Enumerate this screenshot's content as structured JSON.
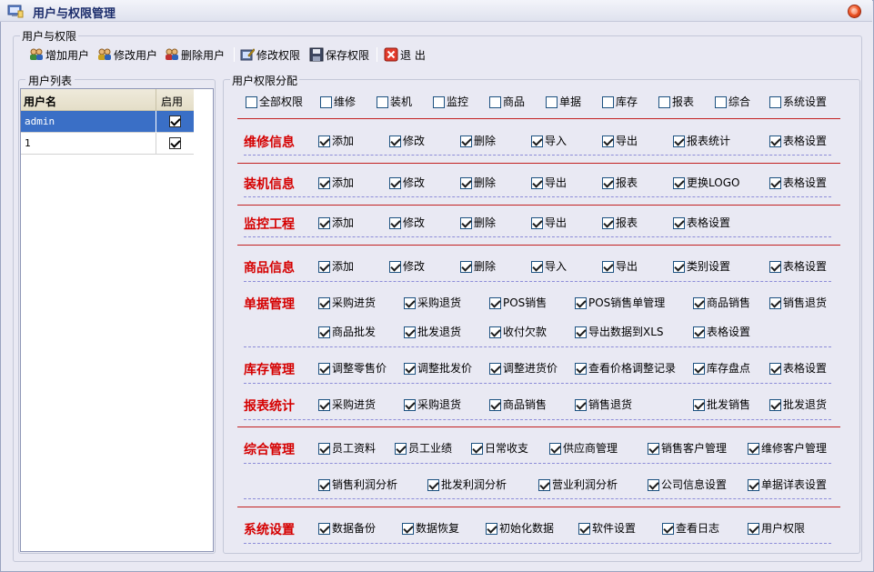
{
  "window": {
    "title": "用户与权限管理"
  },
  "outer_group_label": "用户与权限",
  "toolbar": {
    "add_user": "增加用户",
    "edit_user": "修改用户",
    "delete_user": "删除用户",
    "edit_perm": "修改权限",
    "save_perm": "保存权限",
    "exit": "退 出"
  },
  "user_list": {
    "label": "用户列表",
    "col_name": "用户名",
    "col_enabled": "启用",
    "rows": [
      {
        "name": "admin",
        "enabled": true,
        "selected": true
      },
      {
        "name": "1",
        "enabled": true,
        "selected": false
      }
    ]
  },
  "perms": {
    "label": "用户权限分配",
    "top": [
      "全部权限",
      "维修",
      "装机",
      "监控",
      "商品",
      "单据",
      "库存",
      "报表",
      "综合",
      "系统设置"
    ],
    "categories": {
      "repair": {
        "title": "维修信息",
        "items": [
          "添加",
          "修改",
          "删除",
          "导入",
          "导出",
          "报表统计",
          "表格设置"
        ]
      },
      "assembly": {
        "title": "装机信息",
        "items": [
          "添加",
          "修改",
          "删除",
          "导出",
          "报表",
          "更换LOGO",
          "表格设置"
        ]
      },
      "monitor": {
        "title": "监控工程",
        "items": [
          "添加",
          "修改",
          "删除",
          "导出",
          "报表",
          "表格设置"
        ]
      },
      "goods": {
        "title": "商品信息",
        "items": [
          "添加",
          "修改",
          "删除",
          "导入",
          "导出",
          "类别设置",
          "表格设置"
        ]
      },
      "docs": {
        "title": "单据管理",
        "row1": [
          "采购进货",
          "采购退货",
          "POS销售",
          "POS销售单管理",
          "商品销售",
          "销售退货"
        ],
        "row2": [
          "商品批发",
          "批发退货",
          "收付欠款",
          "导出数据到XLS",
          "表格设置"
        ]
      },
      "stock": {
        "title": "库存管理",
        "items": [
          "调整零售价",
          "调整批发价",
          "调整进货价",
          "查看价格调整记录",
          "库存盘点",
          "表格设置"
        ]
      },
      "report": {
        "title": "报表统计",
        "items": [
          "采购进货",
          "采购退货",
          "商品销售",
          "销售退货",
          "批发销售",
          "批发退货"
        ]
      },
      "general": {
        "title": "综合管理",
        "row1": [
          "员工资料",
          "员工业绩",
          "日常收支",
          "供应商管理",
          "销售客户管理",
          "维修客户管理"
        ],
        "row2": [
          "销售利润分析",
          "批发利润分析",
          "营业利润分析",
          "公司信息设置",
          "单据详表设置"
        ]
      },
      "system": {
        "title": "系统设置",
        "items": [
          "数据备份",
          "数据恢复",
          "初始化数据",
          "软件设置",
          "查看日志",
          "用户权限"
        ]
      }
    }
  },
  "colors": {
    "category_title": "#d50000",
    "selected_row": "#3a6fc6",
    "divider": "#c32020"
  }
}
